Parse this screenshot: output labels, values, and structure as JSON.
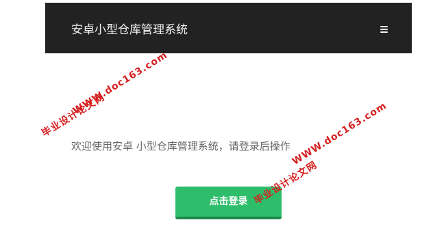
{
  "app": {
    "title": "安卓小型仓库管理系统",
    "menu_icon": "hamburger-menu-icon"
  },
  "main": {
    "welcome_text": "欢迎使用安卓 小型仓库管理系统，请登录后操作",
    "login_button_label": "点击登录"
  },
  "watermarks": [
    {
      "site": "WWW.doc163.com",
      "name": "毕业设计论文网"
    },
    {
      "site": "WWW.doc163.com",
      "name": "毕业设计论文网"
    }
  ],
  "colors": {
    "navbar_bg": "#222222",
    "title_text": "#f2f2f2",
    "body_text": "#666666",
    "button_bg": "#2ebd6b",
    "button_shadow": "#21894d",
    "watermark": "#d61f1f"
  }
}
